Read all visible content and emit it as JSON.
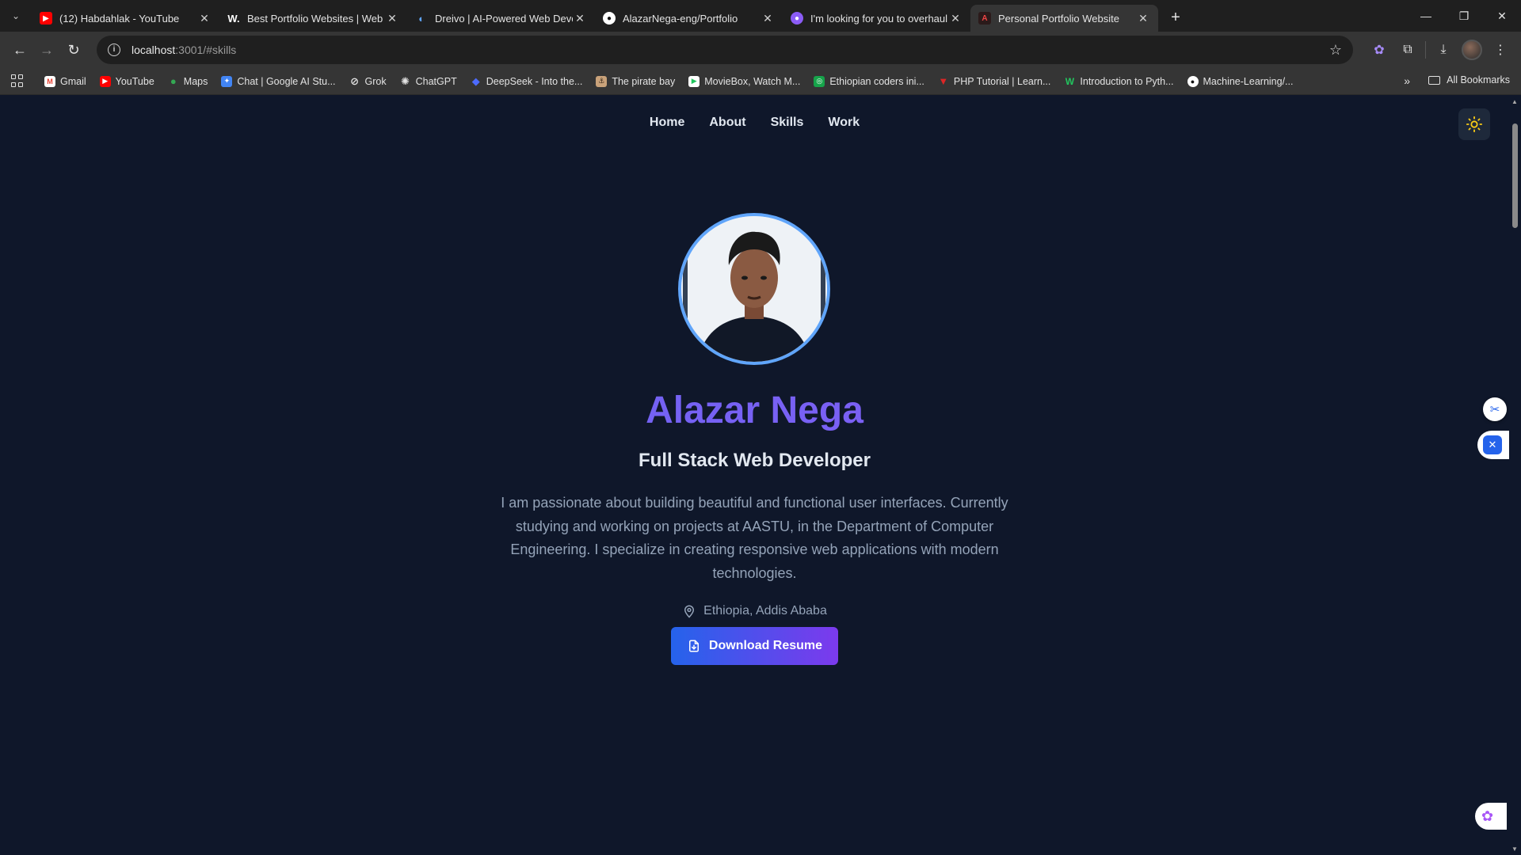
{
  "browser": {
    "tabs": [
      {
        "title": "(12) Habdahlak - YouTube",
        "icon": "youtube-icon",
        "color": "#ff0000",
        "active": false
      },
      {
        "title": "Best Portfolio Websites | Web D",
        "icon": "w-icon",
        "color": "#1f1f1f",
        "active": false
      },
      {
        "title": "Dreivo | AI-Powered Web Devel",
        "icon": "dreivo-icon",
        "color": "#3b82f6",
        "active": false
      },
      {
        "title": "AlazarNega-eng/Portfolio",
        "icon": "github-icon",
        "color": "#ffffff",
        "active": false
      },
      {
        "title": "I'm looking for you to overhaul",
        "icon": "bot-icon",
        "color": "#8b5cf6",
        "active": false
      },
      {
        "title": "Personal Portfolio Website",
        "icon": "site-icon",
        "color": "#111111",
        "active": true
      }
    ],
    "url_host": "localhost",
    "url_path": ":3001/#skills",
    "bookmarks": [
      {
        "label": "Gmail",
        "color": "#ea4335",
        "glyph": "M"
      },
      {
        "label": "YouTube",
        "color": "#ff0000",
        "glyph": "▶"
      },
      {
        "label": "Maps",
        "color": "#34a853",
        "glyph": "●"
      },
      {
        "label": "Chat | Google AI Stu...",
        "color": "#4285f4",
        "glyph": "✦"
      },
      {
        "label": "Grok",
        "color": "#444444",
        "glyph": "⊘"
      },
      {
        "label": "ChatGPT",
        "color": "#555555",
        "glyph": "✺"
      },
      {
        "label": "DeepSeek - Into the...",
        "color": "#4d6bfe",
        "glyph": "◆"
      },
      {
        "label": "The pirate bay",
        "color": "#c9a27a",
        "glyph": "⚓"
      },
      {
        "label": "MovieBox, Watch M...",
        "color": "#22c55e",
        "glyph": "▶"
      },
      {
        "label": "Ethiopian coders ini...",
        "color": "#16a34a",
        "glyph": "◎"
      },
      {
        "label": "PHP Tutorial | Learn...",
        "color": "#dc2626",
        "glyph": "▼"
      },
      {
        "label": "Introduction to Pyth...",
        "color": "#22c55e",
        "glyph": "W"
      },
      {
        "label": "Machine-Learning/...",
        "color": "#ffffff",
        "glyph": "●"
      }
    ],
    "all_bookmarks": "All Bookmarks"
  },
  "nav": {
    "home": "Home",
    "about": "About",
    "skills": "Skills",
    "work": "Work"
  },
  "hero": {
    "name": "Alazar Nega",
    "role": "Full Stack Web Developer",
    "bio": "I am passionate about building beautiful and functional user interfaces. Currently studying and working on projects at AASTU, in the Department of Computer Engineering. I specialize in creating responsive web applications with modern technologies.",
    "location": "Ethiopia, Addis Ababa",
    "resume_button": "Download Resume"
  },
  "colors": {
    "background": "#0f172a",
    "accent_start": "#2563eb",
    "accent_end": "#7c3aed",
    "avatar_ring": "#60a5fa",
    "sun": "#facc15"
  }
}
